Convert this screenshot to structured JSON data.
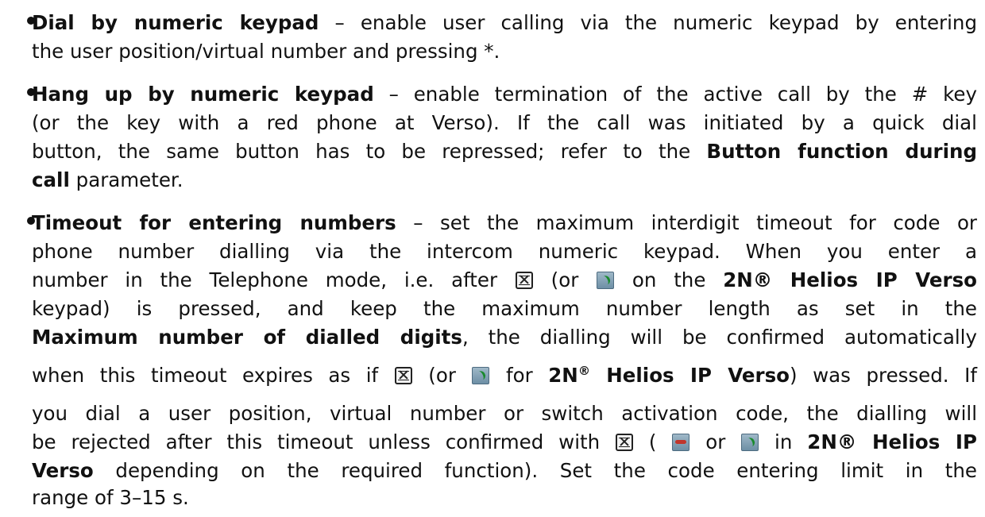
{
  "items": [
    {
      "lines": [
        {
          "bold": "Dial by numeric keypad",
          "text": " – enable user calling via the numeric keypad by entering"
        },
        {
          "text": "the user position/virtual number and pressing *."
        }
      ]
    },
    {
      "lines": [
        {
          "bold": "Hang up by numeric keypad",
          "text": " – enable termination of the active call by the # key"
        },
        {
          "text": "(or the key with a red phone at Verso). If the call was initiated by a quick dial"
        },
        {
          "pre": "button, the same button has to be repressed; refer to the ",
          "bold": "Button function during"
        },
        {
          "bold": "call",
          "text": " parameter."
        }
      ]
    },
    {
      "l1_bold": "Timeout for entering numbers",
      "l1_text": " – set the maximum interdigit timeout for code or",
      "l2": "phone number dialling via the intercom numeric keypad. When you enter a",
      "l3_a": "number in the Telephone mode, i.e. after ",
      "l3_b": " (or ",
      "l3_c": " on the ",
      "l3_bold": "2N® Helios IP Verso",
      "l4": "keypad) is pressed, and keep the maximum number length as set in the",
      "l5_bold": "Maximum number of dialled digits",
      "l5_text": ", the dialling will be confirmed automatically",
      "l6_a": "when this timeout expires as if ",
      "l6_b": " (or ",
      "l6_c": " for ",
      "l6_bold_a": "2N",
      "l6_reg": "®",
      "l6_bold_b": " Helios IP Verso",
      "l6_d": ") was pressed. If",
      "l7": "you dial a user position, virtual number or switch activation code, the dialling will",
      "l8_a": "be rejected after this timeout unless confirmed with ",
      "l8_b": " ( ",
      "l8_c": " or ",
      "l8_d": " in ",
      "l8_bold": "2N® Helios IP",
      "l9_bold": "Verso",
      "l9_text": " depending on the required function). Set the code entering limit in the",
      "l10": "range of 3–15 s."
    }
  ]
}
